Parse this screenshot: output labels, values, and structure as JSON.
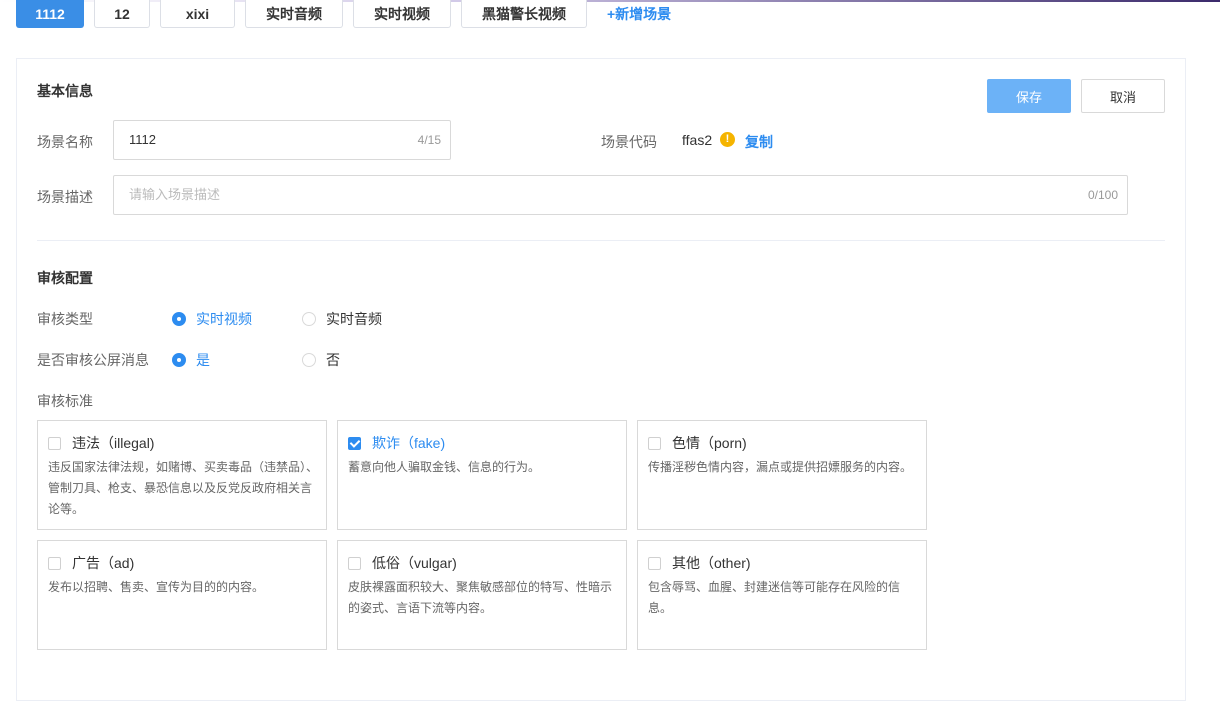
{
  "tabs": [
    {
      "label": "1112",
      "active": true
    },
    {
      "label": "12",
      "active": false
    },
    {
      "label": "xixi",
      "active": false
    },
    {
      "label": "实时音频",
      "active": false
    },
    {
      "label": "实时视频",
      "active": false
    },
    {
      "label": "黑猫警长视频",
      "active": false
    }
  ],
  "add_scene_label": "+新增场景",
  "basic": {
    "title": "基本信息",
    "save_label": "保存",
    "cancel_label": "取消",
    "name_label": "场景名称",
    "name_value": "1112",
    "name_counter": "4/15",
    "code_label": "场景代码",
    "code_value": "ffas2",
    "copy_label": "复制",
    "desc_label": "场景描述",
    "desc_placeholder": "请输入场景描述",
    "desc_counter": "0/100"
  },
  "review": {
    "title": "审核配置",
    "type_label": "审核类型",
    "type_options": [
      "实时视频",
      "实时音频"
    ],
    "type_selected": "实时视频",
    "public_label": "是否审核公屏消息",
    "public_options": [
      "是",
      "否"
    ],
    "public_selected": "是",
    "standard_label": "审核标准",
    "criteria": [
      {
        "title": "违法（illegal)",
        "desc": "违反国家法律法规，如赌博、买卖毒品（违禁品）、管制刀具、枪支、暴恐信息以及反党反政府相关言论等。",
        "checked": false
      },
      {
        "title": "欺诈（fake)",
        "desc": "蓄意向他人骗取金钱、信息的行为。",
        "checked": true
      },
      {
        "title": "色情（porn)",
        "desc": "传播淫秽色情内容，漏点或提供招嫖服务的内容。",
        "checked": false
      },
      {
        "title": "广告（ad)",
        "desc": "发布以招聘、售卖、宣传为目的的内容。",
        "checked": false
      },
      {
        "title": "低俗（vulgar)",
        "desc": "皮肤裸露面积较大、聚焦敏感部位的特写、性暗示的姿式、言语下流等内容。",
        "checked": false
      },
      {
        "title": "其他（other)",
        "desc": "包含辱骂、血腥、封建迷信等可能存在风险的信息。",
        "checked": false
      }
    ]
  },
  "colors": {
    "accent": "#2d8cf0",
    "save_button": "#6cb2f7",
    "warning": "#f5b400"
  },
  "icons": {
    "code_warning": "exclamation-circle-icon"
  }
}
